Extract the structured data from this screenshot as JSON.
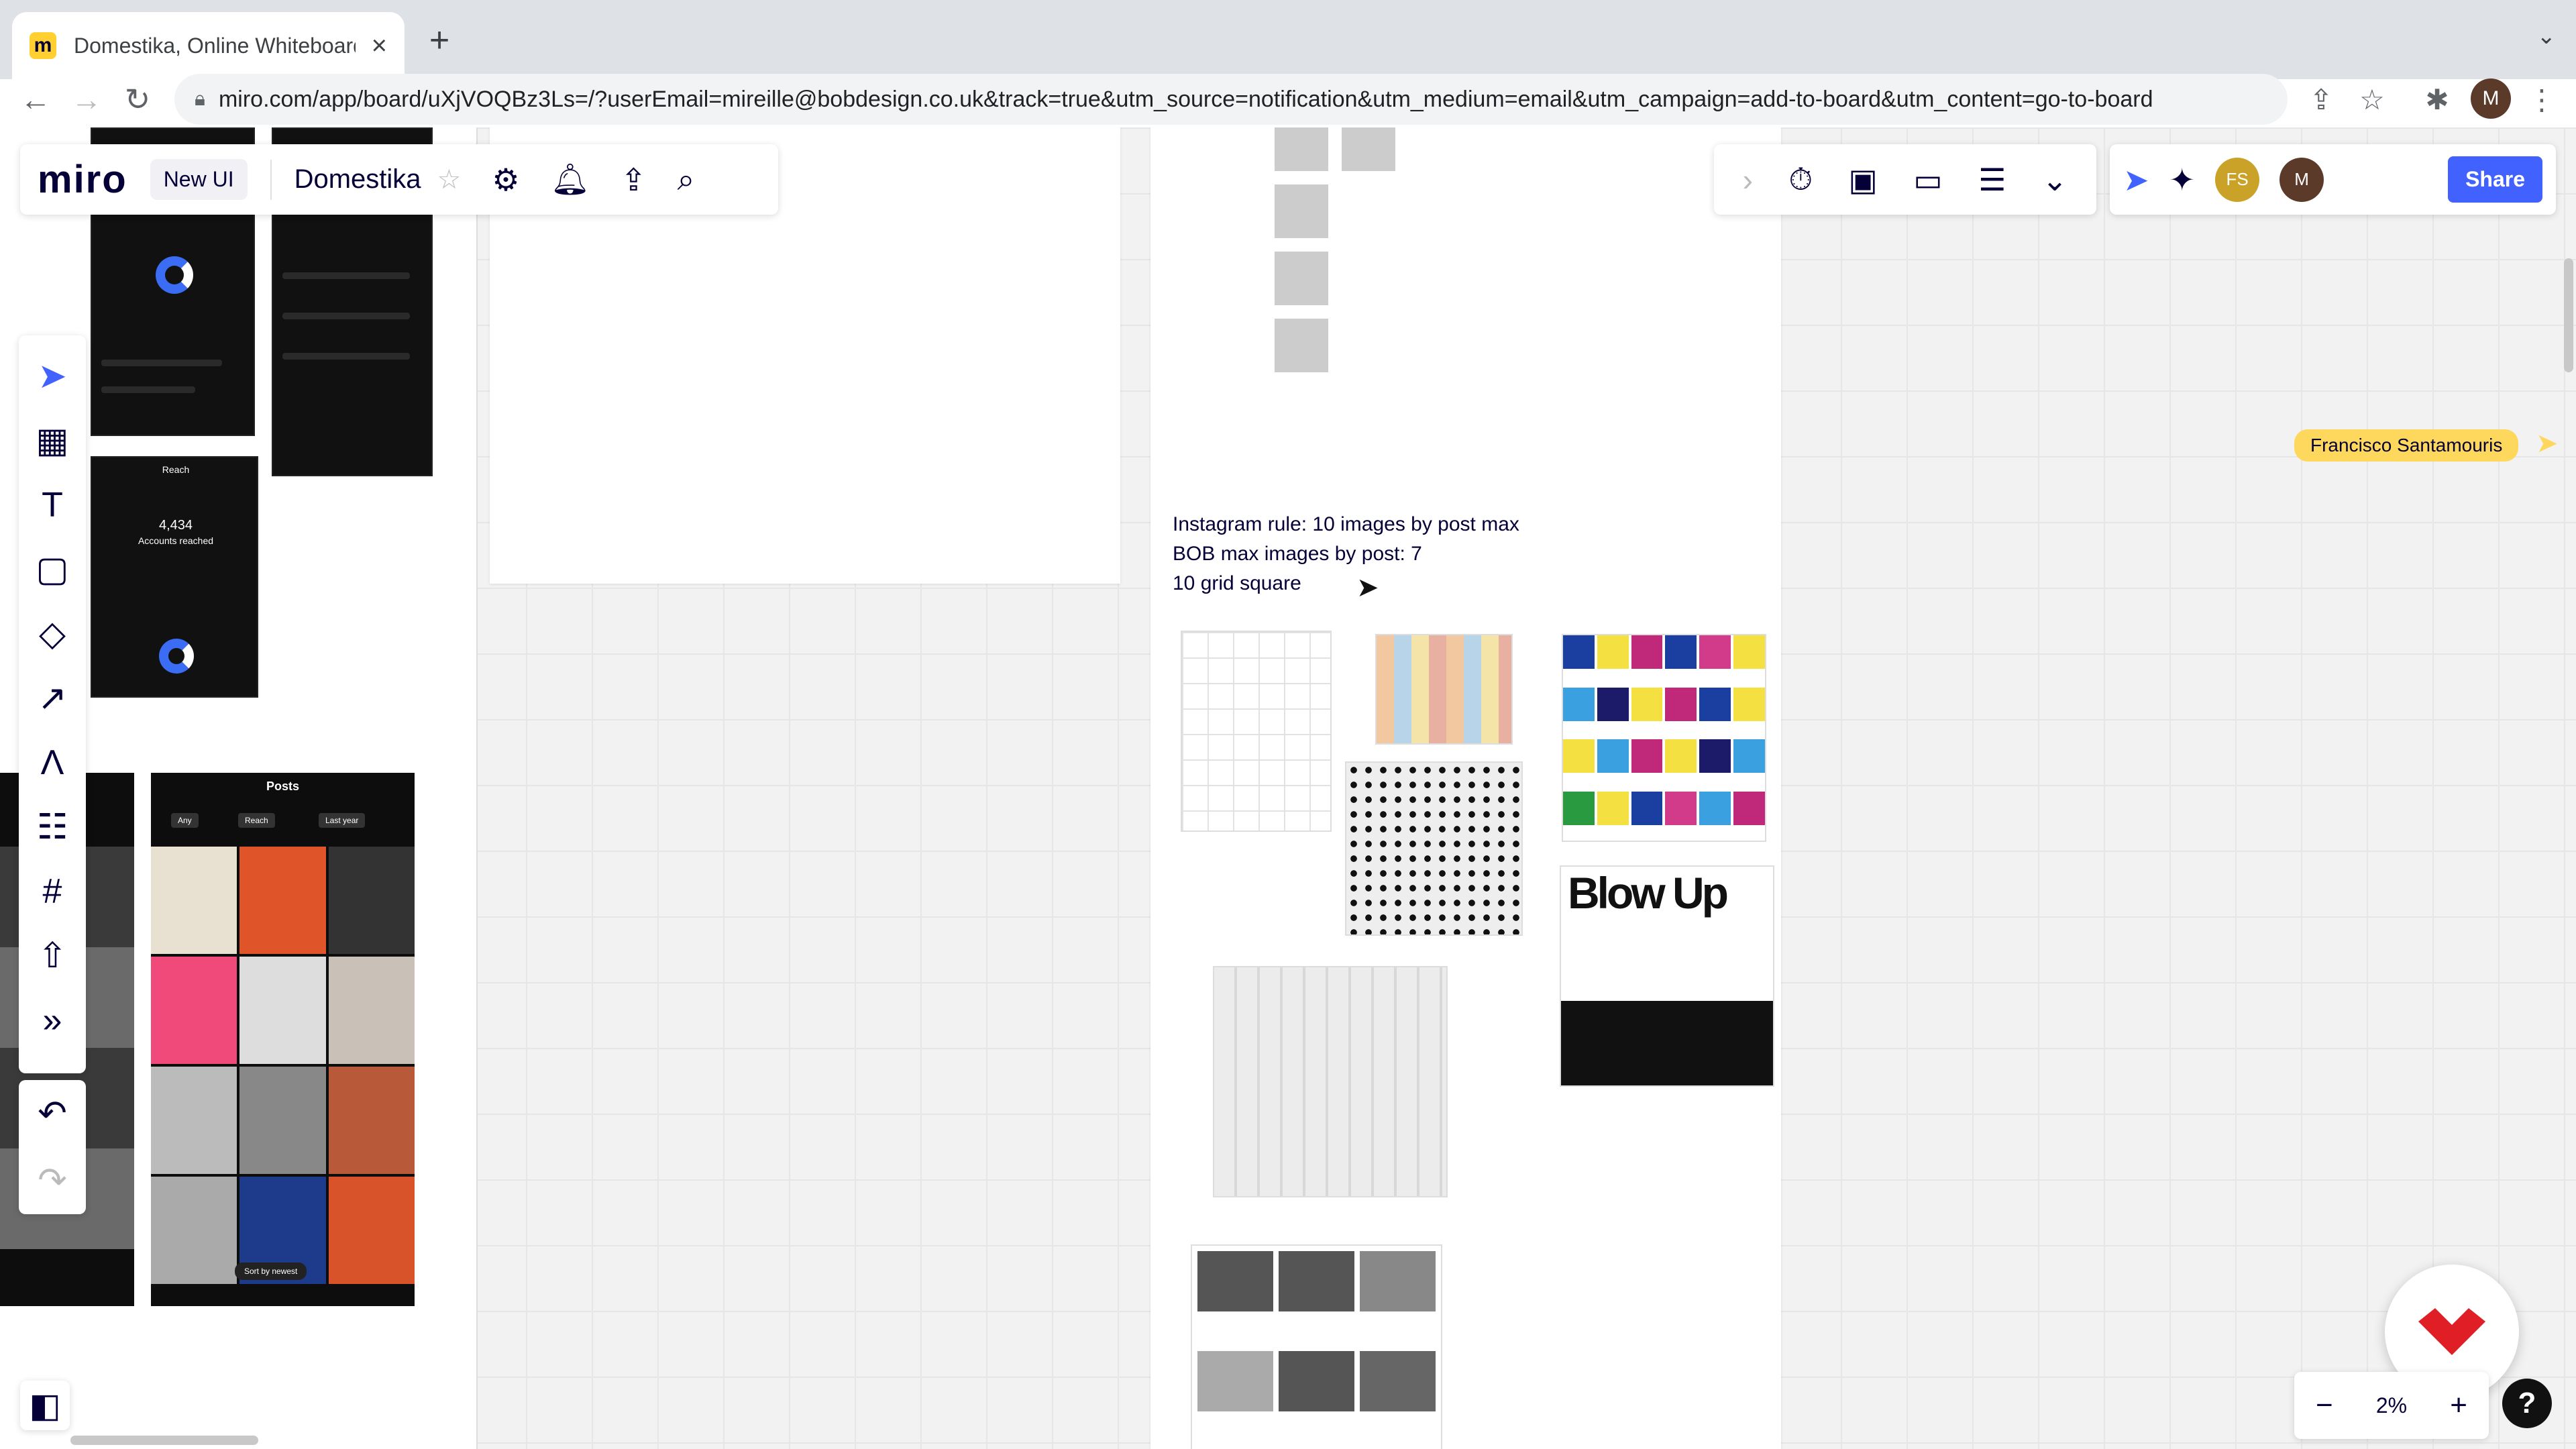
{
  "browser": {
    "tab_title": "Domestika, Online Whiteboard",
    "url": "miro.com/app/board/uXjVOQBz3Ls=/?userEmail=mireille@bobdesign.co.uk&track=true&utm_source=notification&utm_medium=email&utm_campaign=add-to-board&utm_content=go-to-board",
    "profile_initial": "M"
  },
  "miro": {
    "logo": "miro",
    "new_ui_label": "New UI",
    "board_name": "Domestika",
    "share_label": "Share",
    "avatar_fs": "FS",
    "avatar_me": "M",
    "zoom": "2%",
    "help": "?"
  },
  "board": {
    "note_lines": [
      "Instagram rule: 10 images by post max",
      "BOB max images by post: 7",
      "10 grid square"
    ],
    "posts_title": "Posts",
    "posts_filters": [
      "Any",
      "Reach",
      "Last year"
    ],
    "sort_label": "Sort by newest",
    "reach_title": "Reach",
    "reach_value": "4,434",
    "reach_caption": "Accounts reached",
    "blow_up": "Blow Up"
  },
  "collaborator": {
    "name": "Francisco Santamouris",
    "color": "#fdd85d"
  }
}
